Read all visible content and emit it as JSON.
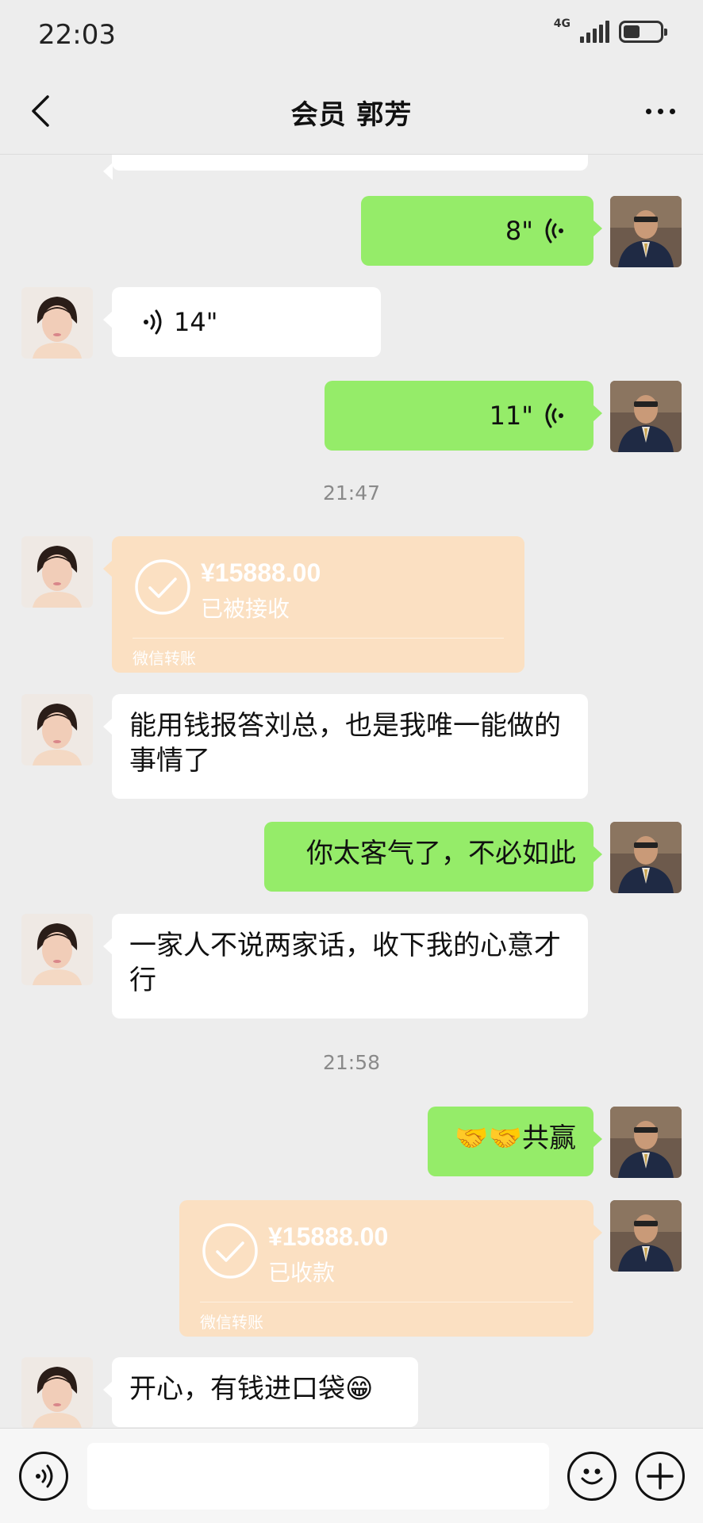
{
  "status_bar": {
    "time": "22:03",
    "network": "4G",
    "battery_level": 0.45
  },
  "header": {
    "title": "会员 郭芳"
  },
  "messages": [
    {
      "side": "right",
      "type": "voice",
      "duration": "8\""
    },
    {
      "side": "left",
      "type": "voice",
      "duration": "14\""
    },
    {
      "side": "right",
      "type": "voice",
      "duration": "11\""
    },
    {
      "type": "timestamp",
      "text": "21:47"
    },
    {
      "side": "left",
      "type": "transfer",
      "amount": "¥15888.00",
      "status": "已被接收",
      "label": "微信转账"
    },
    {
      "side": "left",
      "type": "text",
      "text": "能用钱报答刘总，也是我唯一能做的事情了"
    },
    {
      "side": "right",
      "type": "text",
      "text": "你太客气了，不必如此"
    },
    {
      "side": "left",
      "type": "text",
      "text": "一家人不说两家话，收下我的心意才行"
    },
    {
      "type": "timestamp",
      "text": "21:58"
    },
    {
      "side": "right",
      "type": "text",
      "text": "🤝🤝共赢"
    },
    {
      "side": "right",
      "type": "transfer",
      "amount": "¥15888.00",
      "status": "已收款",
      "label": "微信转账"
    },
    {
      "side": "left",
      "type": "text",
      "text": "开心，有钱进口袋😁"
    }
  ],
  "input_bar": {
    "placeholder": ""
  },
  "colors": {
    "background": "#ededed",
    "self_bubble": "#95ec69",
    "other_bubble": "#ffffff",
    "transfer_card": "#fbe0c2"
  }
}
